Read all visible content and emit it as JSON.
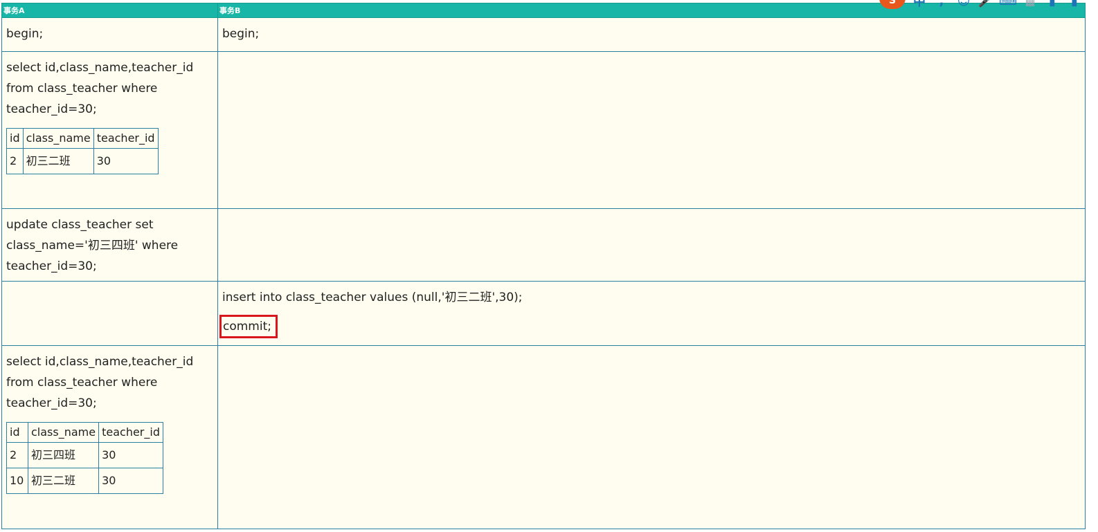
{
  "headers": {
    "a": "事务A",
    "b": "事务B"
  },
  "rows": {
    "begin": {
      "a": "begin;",
      "b": "begin;"
    },
    "select1": {
      "a_lines": [
        "select id,class_name,teacher_id",
        "from class_teacher where",
        "teacher_id=30;"
      ],
      "result": {
        "columns": [
          "id",
          "class_name",
          "teacher_id"
        ],
        "rows": [
          [
            "2",
            "初三二班",
            "30"
          ]
        ]
      }
    },
    "update": {
      "a_lines": [
        "update class_teacher set",
        "class_name='初三四班' where",
        "teacher_id=30;"
      ]
    },
    "insert": {
      "b_insert": "insert into class_teacher values (null,'初三二班',30);",
      "b_commit": "commit;"
    },
    "select2": {
      "a_lines": [
        "select id,class_name,teacher_id",
        "from class_teacher where",
        "teacher_id=30;"
      ],
      "result": {
        "columns": [
          "id",
          "class_name",
          "teacher_id"
        ],
        "rows": [
          [
            "2",
            "初三四班",
            "30"
          ],
          [
            "10",
            "初三二班",
            "30"
          ]
        ]
      }
    }
  },
  "toolbar": {
    "logo": "S",
    "icons": [
      "input-mode-icon",
      "punctuation-icon",
      "emoji-icon",
      "voice-icon",
      "keyboard-icon",
      "skin-icon",
      "toolbox-icon",
      "menu-icon"
    ]
  },
  "colors": {
    "header_bg": "#18b6a6",
    "cell_bg": "#fffdef",
    "border": "#2a7fa0",
    "highlight": "#d9161c"
  }
}
